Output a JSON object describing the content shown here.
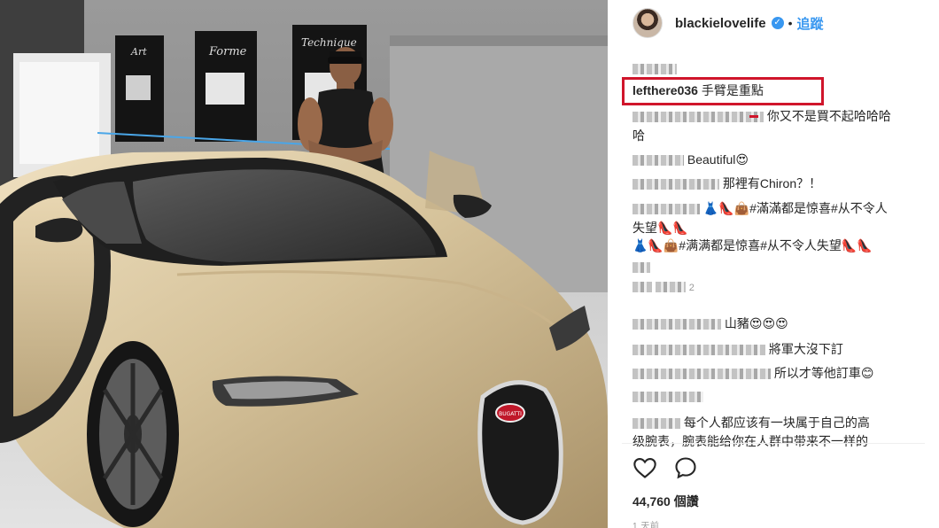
{
  "post": {
    "username": "blackielovelife",
    "verified_icon": "verified-badge-icon",
    "separator": "•",
    "follow_label": "追蹤"
  },
  "photo": {
    "description_icon": "car-photo",
    "wall_signs": [
      "Art",
      "Forme",
      "Technique"
    ],
    "badge_text": "BUGATTI"
  },
  "comments": [
    {
      "user": "",
      "text": ""
    },
    {
      "user": "lefthere036",
      "text": "手臂是重點",
      "highlighted": true
    },
    {
      "user": "",
      "text": "你又不是買不起哈哈哈"
    },
    {
      "user": "",
      "text": "哈"
    },
    {
      "user": "",
      "text": "Beautiful😍"
    },
    {
      "user": "",
      "text": "那裡有Chiron？！"
    },
    {
      "user": "",
      "text": "👗👠👜#滿滿都是惊喜#从不令人"
    },
    {
      "user": "",
      "text": "失望👠👠"
    },
    {
      "user": "",
      "text": "👗👠👜#满满都是惊喜#从不令人失望👠👠"
    },
    {
      "user": "",
      "text": ""
    },
    {
      "user": "",
      "text": "2"
    },
    {
      "user": "",
      "text": "山豬😍😍😍"
    },
    {
      "user": "",
      "text": "將軍大沒下訂"
    },
    {
      "user": "",
      "text": "所以才等他訂車😊"
    },
    {
      "user": "",
      "text": ""
    },
    {
      "user": "",
      "text": "每个人都应该有一块属于自己的高"
    },
    {
      "user": "",
      "text": "级腕表，腕表能给你在人群中带来不一样的"
    }
  ],
  "actions": {
    "like_icon": "heart-icon",
    "comment_icon": "comment-icon"
  },
  "likes": "44,760 個讚",
  "time": "1 天前",
  "colors": {
    "accent": "#3897f0",
    "highlight": "#d0152b",
    "text": "#262626"
  }
}
